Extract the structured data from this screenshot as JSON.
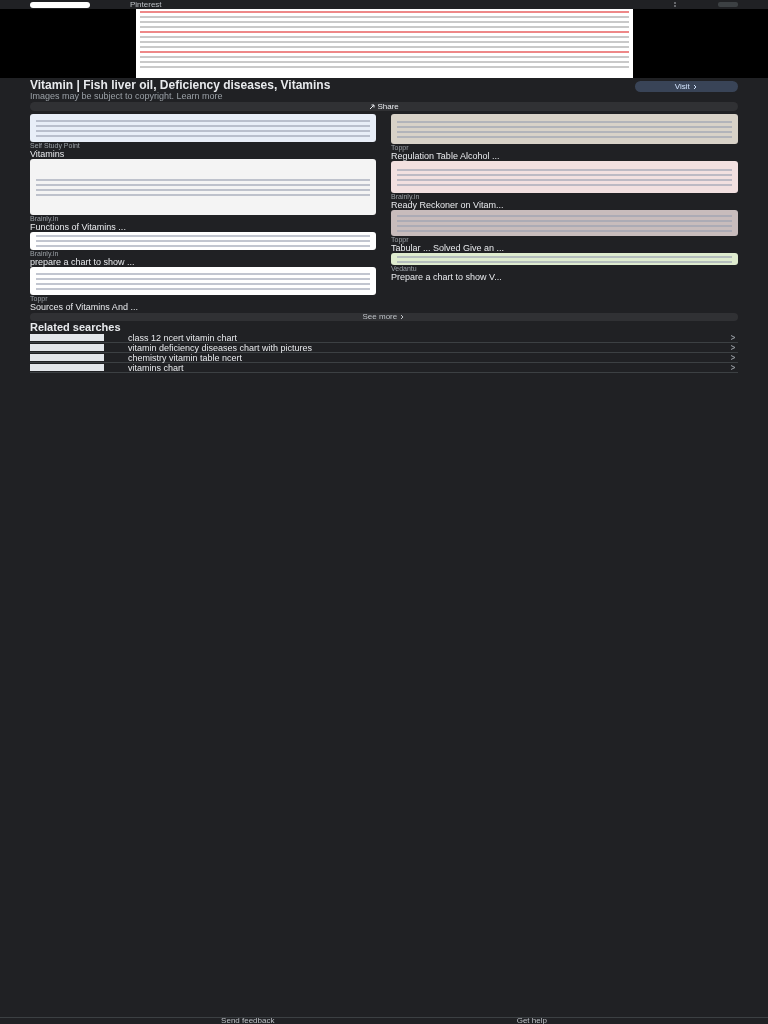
{
  "header": {
    "source": "Pinterest"
  },
  "title": "Vitamin | Fish liver oil, Deficiency diseases, Vitamins",
  "notice": {
    "text": "Images may be subject to copyright.",
    "link": "Learn more"
  },
  "visit_button": "Visit",
  "share_button": "Share",
  "results": {
    "left": [
      {
        "source": "Self Study Point",
        "title": "Vitamins"
      },
      {
        "source": "Brainly.in",
        "title": "Functions of Vitamins ..."
      },
      {
        "source": "Brainly.in",
        "title": "prepare a chart to show ..."
      },
      {
        "source": "Toppr",
        "title": "Sources of Vitamins And ..."
      }
    ],
    "right": [
      {
        "source": "Toppr",
        "title": "Regulation Table Alcohol ..."
      },
      {
        "source": "Brainly.in",
        "title": "Ready Reckoner on Vitam..."
      },
      {
        "source": "Toppr",
        "title": "Tabular ... Solved Give an ..."
      },
      {
        "source": "Vedantu",
        "title": "Prepare a chart to show V..."
      }
    ]
  },
  "see_more": "See more",
  "related": {
    "heading": "Related searches",
    "items": [
      "class 12 ncert vitamin chart",
      "vitamin deficiency diseases chart with pictures",
      "chemistry vitamin table ncert",
      "vitamins chart"
    ]
  },
  "footer": [
    "Send feedback",
    "Get help"
  ]
}
